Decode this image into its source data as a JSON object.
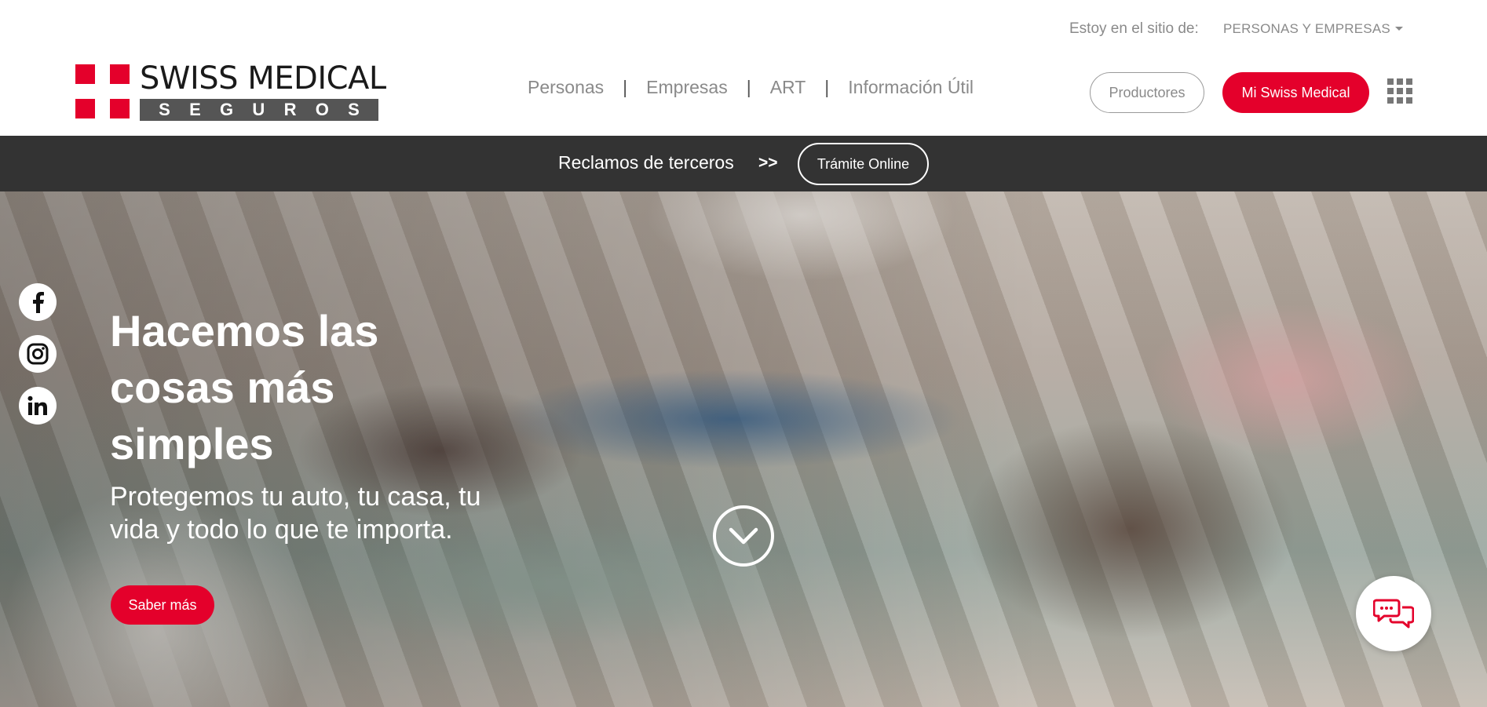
{
  "topbar": {
    "site_label": "Estoy en el sitio de:",
    "site_selected": "PERSONAS Y EMPRESAS"
  },
  "logo": {
    "brand": "SWISS MEDICAL",
    "sub_letters": [
      "S",
      "E",
      "G",
      "U",
      "R",
      "O",
      "S"
    ]
  },
  "nav": {
    "items": [
      {
        "label": "Personas"
      },
      {
        "label": "Empresas"
      },
      {
        "label": "ART"
      },
      {
        "label": "Información Útil"
      }
    ],
    "separator": "|"
  },
  "header": {
    "productores_label": "Productores",
    "mi_swiss_label": "Mi Swiss Medical"
  },
  "strip": {
    "text": "Reclamos de terceros",
    "arrows": ">>",
    "button_label": "Trámite Online"
  },
  "hero": {
    "title_lines": [
      "Hacemos las",
      "cosas más",
      "simples"
    ],
    "subtitle": "Protegemos tu auto, tu casa, tu vida y todo lo que te importa.",
    "button_label": "Saber más"
  },
  "social": [
    "facebook-icon",
    "instagram-icon",
    "linkedin-icon"
  ],
  "colors": {
    "brand_red": "#e4002b",
    "strip_dark": "#333333",
    "nav_gray": "#8a8a8a"
  }
}
